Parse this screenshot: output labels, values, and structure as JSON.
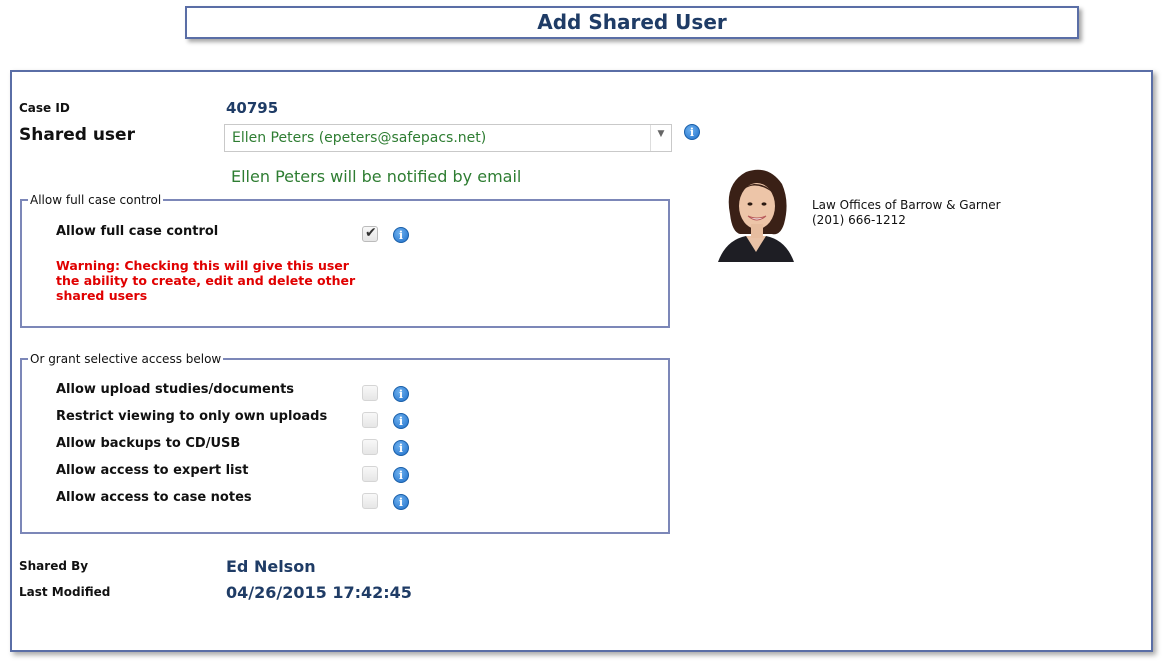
{
  "page": {
    "title": "Add Shared User"
  },
  "case": {
    "id_label": "Case ID",
    "id_value": "40795"
  },
  "shared_user": {
    "label": "Shared user",
    "selected": "Ellen Peters (epeters@safepacs.net)",
    "notify_text": "Ellen Peters will be notified by email"
  },
  "contact": {
    "company": "Law Offices of Barrow & Garner",
    "phone": "(201) 666-1212"
  },
  "full_control": {
    "legend": "Allow full case control",
    "label": "Allow full case control",
    "checked": true,
    "warning": "Warning: Checking this will give this user the ability to create, edit and delete other shared users"
  },
  "selective": {
    "legend": "Or grant selective access below",
    "items": [
      {
        "label": "Allow upload studies/documents",
        "checked": false
      },
      {
        "label": "Restrict viewing to only own uploads",
        "checked": false
      },
      {
        "label": "Allow backups to CD/USB",
        "checked": false
      },
      {
        "label": "Allow access to expert list",
        "checked": false
      },
      {
        "label": "Allow access to case notes",
        "checked": false
      }
    ]
  },
  "meta": {
    "shared_by_label": "Shared By",
    "shared_by_value": "Ed Nelson",
    "last_modified_label": "Last Modified",
    "last_modified_value": "04/26/2015 17:42:45"
  },
  "icons": {
    "info": "info-icon",
    "dropdown": "dropdown-arrow-icon",
    "check": "check-icon"
  },
  "colors": {
    "title": "#1f3c66",
    "green": "#2e7d32",
    "warning": "#e00000",
    "border": "#5a6ea6"
  }
}
